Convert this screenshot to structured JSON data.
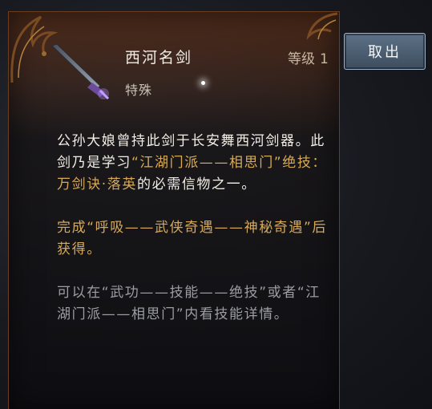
{
  "item": {
    "name": "西河名剑",
    "type": "特殊",
    "level_label": "等级",
    "level_value": "1"
  },
  "description": {
    "p1": [
      {
        "text": "公孙大娘曾持此剑于长安舞西河剑器。此剑乃是学习",
        "style": "white"
      },
      {
        "text": "“江湖门派——相思门”绝技：万剑诀·落英",
        "style": "gold"
      },
      {
        "text": "的必需信物之一。",
        "style": "white"
      }
    ],
    "p2": [
      {
        "text": "完成“呼吸——武侠奇遇——神秘奇遇”后获得。",
        "style": "gold"
      }
    ],
    "p3": [
      {
        "text": "可以在“武功——技能——绝技”或者“江湖门派——相思门”内",
        "style": "grey"
      },
      {
        "text": "看技能详情。",
        "style": "grey"
      }
    ]
  },
  "actions": {
    "take_out_label": "取出"
  },
  "icons": [
    "sword-icon",
    "ornament-left",
    "ornament-right",
    "sparkle-icon"
  ],
  "colors": {
    "gold_text": "#d7aa58",
    "body_text": "#f3efe6",
    "muted_text": "#9c9ea3",
    "button_bg": "#4d6073"
  }
}
